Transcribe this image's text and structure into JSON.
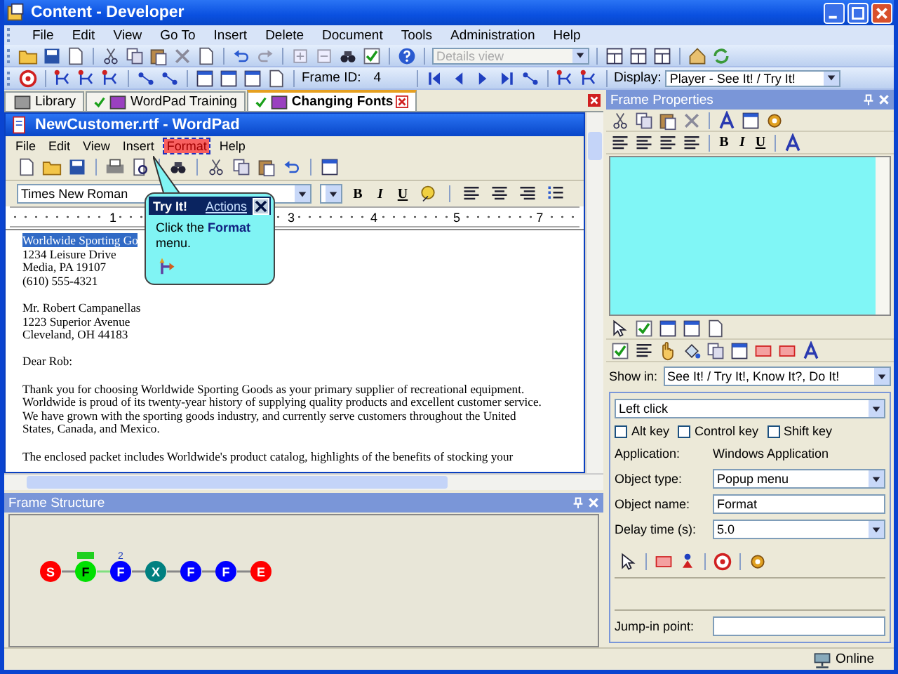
{
  "window": {
    "title": "Content - Developer"
  },
  "menu": [
    "File",
    "Edit",
    "View",
    "Go To",
    "Insert",
    "Delete",
    "Document",
    "Tools",
    "Administration",
    "Help"
  ],
  "toolbar": {
    "view_select": "Details view",
    "frame_id_label": "Frame ID:",
    "frame_id": "4",
    "display_label": "Display:",
    "display_select": "Player - See It! / Try It!"
  },
  "tabs": [
    {
      "label": "Library",
      "checked": false,
      "selected": false
    },
    {
      "label": "WordPad Training",
      "checked": true,
      "selected": false
    },
    {
      "label": "Changing Fonts",
      "checked": true,
      "selected": true
    }
  ],
  "wordpad": {
    "title": "NewCustomer.rtf - WordPad",
    "menu": [
      {
        "label": "File",
        "highlighted": false
      },
      {
        "label": "Edit",
        "highlighted": false
      },
      {
        "label": "View",
        "highlighted": false
      },
      {
        "label": "Insert",
        "highlighted": false
      },
      {
        "label": "Format",
        "highlighted": true
      },
      {
        "label": "Help",
        "highlighted": false
      }
    ],
    "font": "Times New Roman",
    "style_buttons": [
      "B",
      "I",
      "U"
    ],
    "ruler": [
      "1",
      "3",
      "4",
      "5",
      "7"
    ],
    "document": [
      {
        "lines": [
          {
            "text": "Worldwide Sporting Go",
            "selected": true
          },
          {
            "text": "1234 Leisure Drive",
            "selected": false
          },
          {
            "text": "Media, PA 19107",
            "selected": false
          },
          {
            "text": "(610) 555-4321",
            "selected": false
          }
        ]
      },
      {
        "lines": [
          {
            "text": "Mr. Robert Campanellas",
            "selected": false
          },
          {
            "text": "1223 Superior Avenue",
            "selected": false
          },
          {
            "text": "Cleveland, OH  44183",
            "selected": false
          }
        ]
      },
      {
        "lines": [
          {
            "text": "Dear Rob:",
            "selected": false
          }
        ]
      },
      {
        "lines": [
          {
            "text": "Thank you for choosing Worldwide Sporting Goods as your primary supplier of recreational equipment.",
            "selected": false
          },
          {
            "text": "Worldwide is proud of its twenty-year history of supplying quality products and excellent customer service.",
            "selected": false
          },
          {
            "text": "We have grown with the sporting goods industry, and currently serve customers throughout the United",
            "selected": false
          },
          {
            "text": "States, Canada, and Mexico.",
            "selected": false
          }
        ]
      },
      {
        "lines": [
          {
            "text": "The enclosed packet includes Worldwide's product catalog, highlights of the benefits of stocking your",
            "selected": false
          }
        ]
      }
    ]
  },
  "callout": {
    "title": "Try It!",
    "link": "Actions",
    "text": "Click the **Format** menu."
  },
  "frame_structure": {
    "title": "Frame Structure",
    "nodes": [
      {
        "letter": "S",
        "color": "#ff0000",
        "selected": false,
        "tag": false
      },
      {
        "letter": "F",
        "color": "#00e000",
        "selected": true,
        "tag": true
      },
      {
        "letter": "F",
        "color": "#0000ff",
        "selected": false,
        "tag": false,
        "note": "2"
      },
      {
        "letter": "X",
        "color": "#008080",
        "selected": false,
        "tag": false
      },
      {
        "letter": "F",
        "color": "#0000ff",
        "selected": false,
        "tag": false
      },
      {
        "letter": "F",
        "color": "#0000ff",
        "selected": false,
        "tag": false
      },
      {
        "letter": "E",
        "color": "#ff0000",
        "selected": false,
        "tag": false
      }
    ]
  },
  "frame_properties": {
    "title": "Frame Properties",
    "style_buttons": [
      "B",
      "I",
      "U"
    ],
    "show_in_label": "Show in:",
    "show_in": "See It! / Try It!, Know It?, Do It!",
    "action": "Left click",
    "modifiers": [
      {
        "label": "Alt key",
        "checked": false
      },
      {
        "label": "Control key",
        "checked": false
      },
      {
        "label": "Shift key",
        "checked": false
      }
    ],
    "fields": [
      {
        "kind": "text",
        "label": "Application:",
        "value": "Windows Application"
      },
      {
        "kind": "dropdown",
        "label": "Object type:",
        "value": "Popup menu"
      },
      {
        "kind": "input",
        "label": "Object name:",
        "value": "Format"
      },
      {
        "kind": "dropdown",
        "label": "Delay time (s):",
        "value": "5.0"
      }
    ],
    "jump_in_label": "Jump-in point:"
  },
  "status_bar": {
    "text": "Online"
  }
}
